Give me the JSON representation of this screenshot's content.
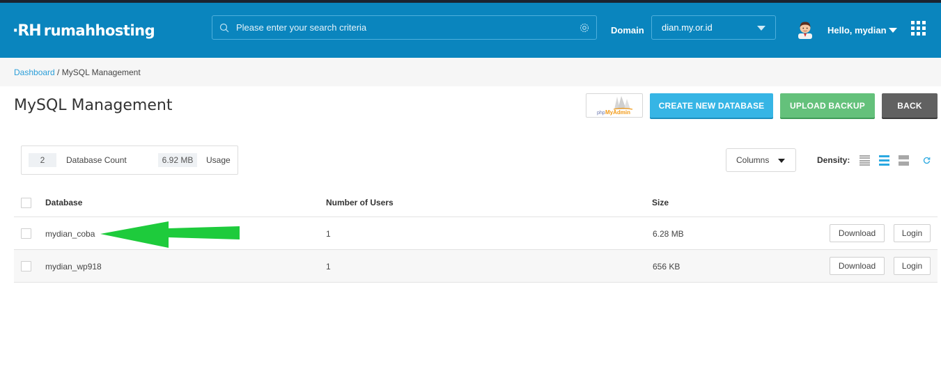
{
  "header": {
    "logo_mark": "·RH",
    "logo_text": "rumahhosting",
    "search_placeholder": "Please enter your search criteria",
    "domain_label": "Domain",
    "domain_value": "dian.my.or.id",
    "greeting": "Hello, mydian"
  },
  "breadcrumb": {
    "home": "Dashboard",
    "separator": " / ",
    "current": "MySQL Management"
  },
  "page": {
    "title": "MySQL Management"
  },
  "actions": {
    "phpmyadmin_php": "php",
    "phpmyadmin_admin": "MyAdmin",
    "create_label": "CREATE NEW DATABASE",
    "upload_label": "UPLOAD BACKUP",
    "back_label": "BACK"
  },
  "stats": {
    "db_count": "2",
    "db_count_label": "Database Count",
    "usage": "6.92 MB",
    "usage_label": "Usage"
  },
  "toolbar": {
    "columns_label": "Columns",
    "density_label": "Density:"
  },
  "table": {
    "headers": [
      "Database",
      "Number of Users",
      "Size"
    ],
    "rows": [
      {
        "database": "mydian_coba",
        "users": "1",
        "size": "6.28 MB",
        "download": "Download",
        "login": "Login"
      },
      {
        "database": "mydian_wp918",
        "users": "1",
        "size": "656 KB",
        "download": "Download",
        "login": "Login"
      }
    ]
  },
  "colors": {
    "header_bg": "#0a85be",
    "create_btn": "#36b5e5",
    "upload_btn": "#64c17b",
    "back_btn": "#616161",
    "link": "#2c9fd9",
    "annotation_arrow": "#1ecb3c"
  },
  "icons": {
    "search": "search-icon",
    "settings": "gear-icon",
    "dropdown": "chevron-down-icon",
    "apps": "grid-icon",
    "refresh": "refresh-icon",
    "annotation": "arrow-left-icon"
  }
}
